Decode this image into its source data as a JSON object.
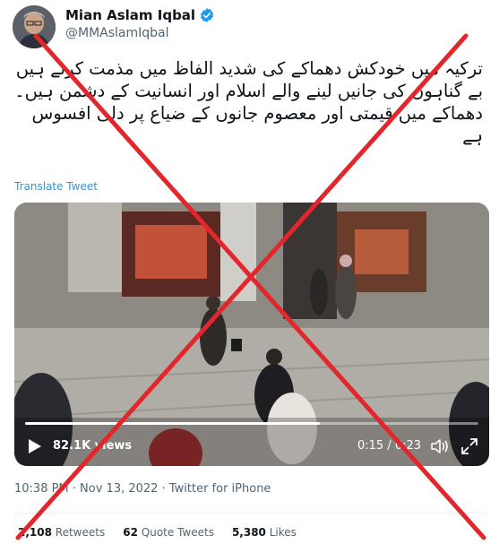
{
  "author": {
    "name": "Mian Aslam Iqbal",
    "handle": "@MMAslamIqbal",
    "avatar_icon": "profile-avatar",
    "verified_icon": "verified-badge-icon"
  },
  "tweet": {
    "text": "ترکیہ میں خودکش دھماکے کی شدید الفاظ میں مذمت کرتے ہیں بے گناہوں کی جانیں لینے والے اسلام اور انسانیت کے دشمن ہیں۔\nدھماکے میں قیمتی اور معصوم جانوں کے ضیاع پر دلی افسوس ہے",
    "translate_label": "Translate Tweet"
  },
  "video": {
    "views": "82.1K views",
    "time": "0:15 / 0:23",
    "progress": 0.65,
    "play_icon": "play-icon",
    "volume_icon": "volume-icon",
    "fullscreen_icon": "fullscreen-icon"
  },
  "meta": {
    "text": "10:38 PM · Nov 13, 2022 · Twitter for iPhone"
  },
  "stats": {
    "retweets_count": "2,108",
    "retweets_label": "Retweets",
    "quotes_count": "62",
    "quotes_label": "Quote Tweets",
    "likes_count": "5,380",
    "likes_label": "Likes"
  },
  "colors": {
    "accent": "#1d9bf0",
    "cross": "#e3262b",
    "secondary_text": "#536471"
  }
}
